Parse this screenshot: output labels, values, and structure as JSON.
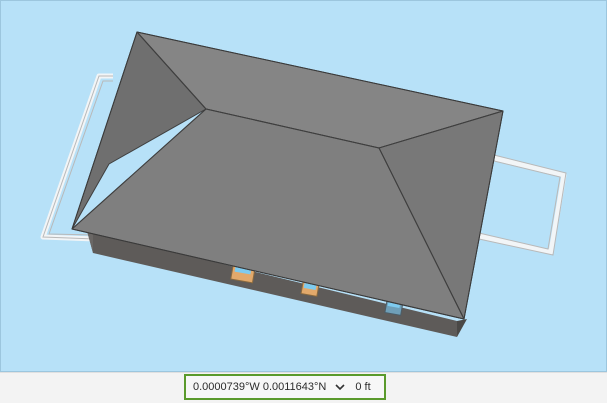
{
  "status_bar": {
    "coordinates": "0.0000739°W 0.0011643°N",
    "units_dropdown_icon": "chevron-down-icon",
    "elevation": "0 ft"
  },
  "scene": {
    "background_color": "#b7e1f8",
    "roof_color": "#7f7f7f",
    "wall_color": "#5e5b59",
    "door_color": "#e2a96b",
    "window_color": "#7ecbef",
    "highlight_border_color": "#5a9a2c"
  }
}
